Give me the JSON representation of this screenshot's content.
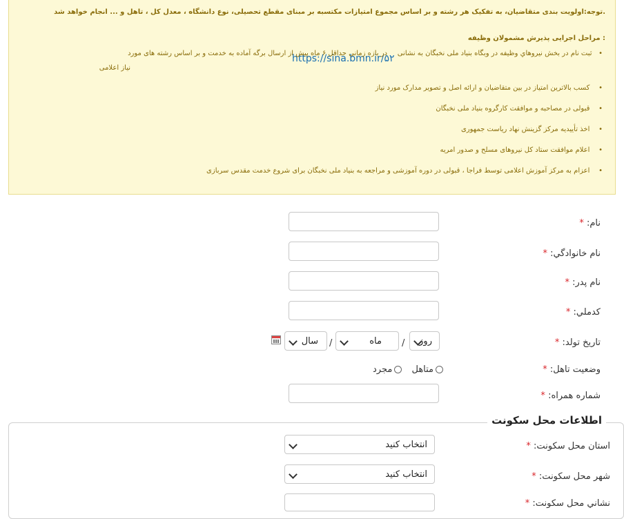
{
  "notice": {
    "top_text": "توجه:اولویت بندی متقاضیان، به تفکیک هر رشته و بر اساس مجموع امتیازات مکتسبه بر مبنای مقطع تحصیلی، نوع دانشگاه ، معدل کل ، تاهل و ... انجام خواهد شد.",
    "heading": "مراحل اجرایی پذیرش مشمولان وظیفه :",
    "bullet": "•",
    "step1_part1": "ثبت نام در بخش  نیروهاي وظیفه در وبگاه بنیاد ملی نخبگان به نشانی",
    "step1_link": "https://sina.bmn.ir/۵۲",
    "step1_part2": "در بازه زمانی حداقل ۶ ماه پیش از ارسال برگه آماده به خدمت و بر اساس رشته های مورد",
    "step1_part3": "نیاز اعلامی",
    "step2": "کسب بالاترین امتیاز در بین متقاضیان و ارائه اصل و تصویر مدارک مورد نیاز",
    "step3": "قبولی در مصاحبه و موافقت کارگروه بنیاد ملی نخبگان",
    "step4": "اخذ تأییدیه مرکز گزینش نهاد ریاست جمهوری",
    "step5": "اعلام موافقت ستاد کل نیروهای مسلح و صدور امریه",
    "step6": "اعزام به مرکز آموزش اعلامی توسط فراجا ، قبولی در دوره آموزشی و مراجعه به بنیاد ملی نخبگان برای شروع خدمت مقدس سربازی"
  },
  "form": {
    "required_mark": "*",
    "first_name_label": "نام:",
    "last_name_label": "نام خانوادگي:",
    "father_name_label": "نام پدر:",
    "national_code_label": "كدملي:",
    "birth_date_label": "تاريخ تولد:",
    "birth_day": "روز",
    "birth_month": "ماه",
    "birth_year": "سال",
    "date_separator": "/",
    "marital_label": "وضعيت تاهل:",
    "marital_option_married": "متاهل",
    "marital_option_single": "مجرد",
    "mobile_label": "شماره همراه:"
  },
  "residence": {
    "legend": "اطلاعات محل سکونت",
    "province_label": "استان محل سکونت:",
    "province_value": "انتخاب کنید",
    "city_label": "شهر محل سکونت:",
    "city_value": "انتخاب کنید",
    "address_label": "نشاني محل سکونت:"
  }
}
